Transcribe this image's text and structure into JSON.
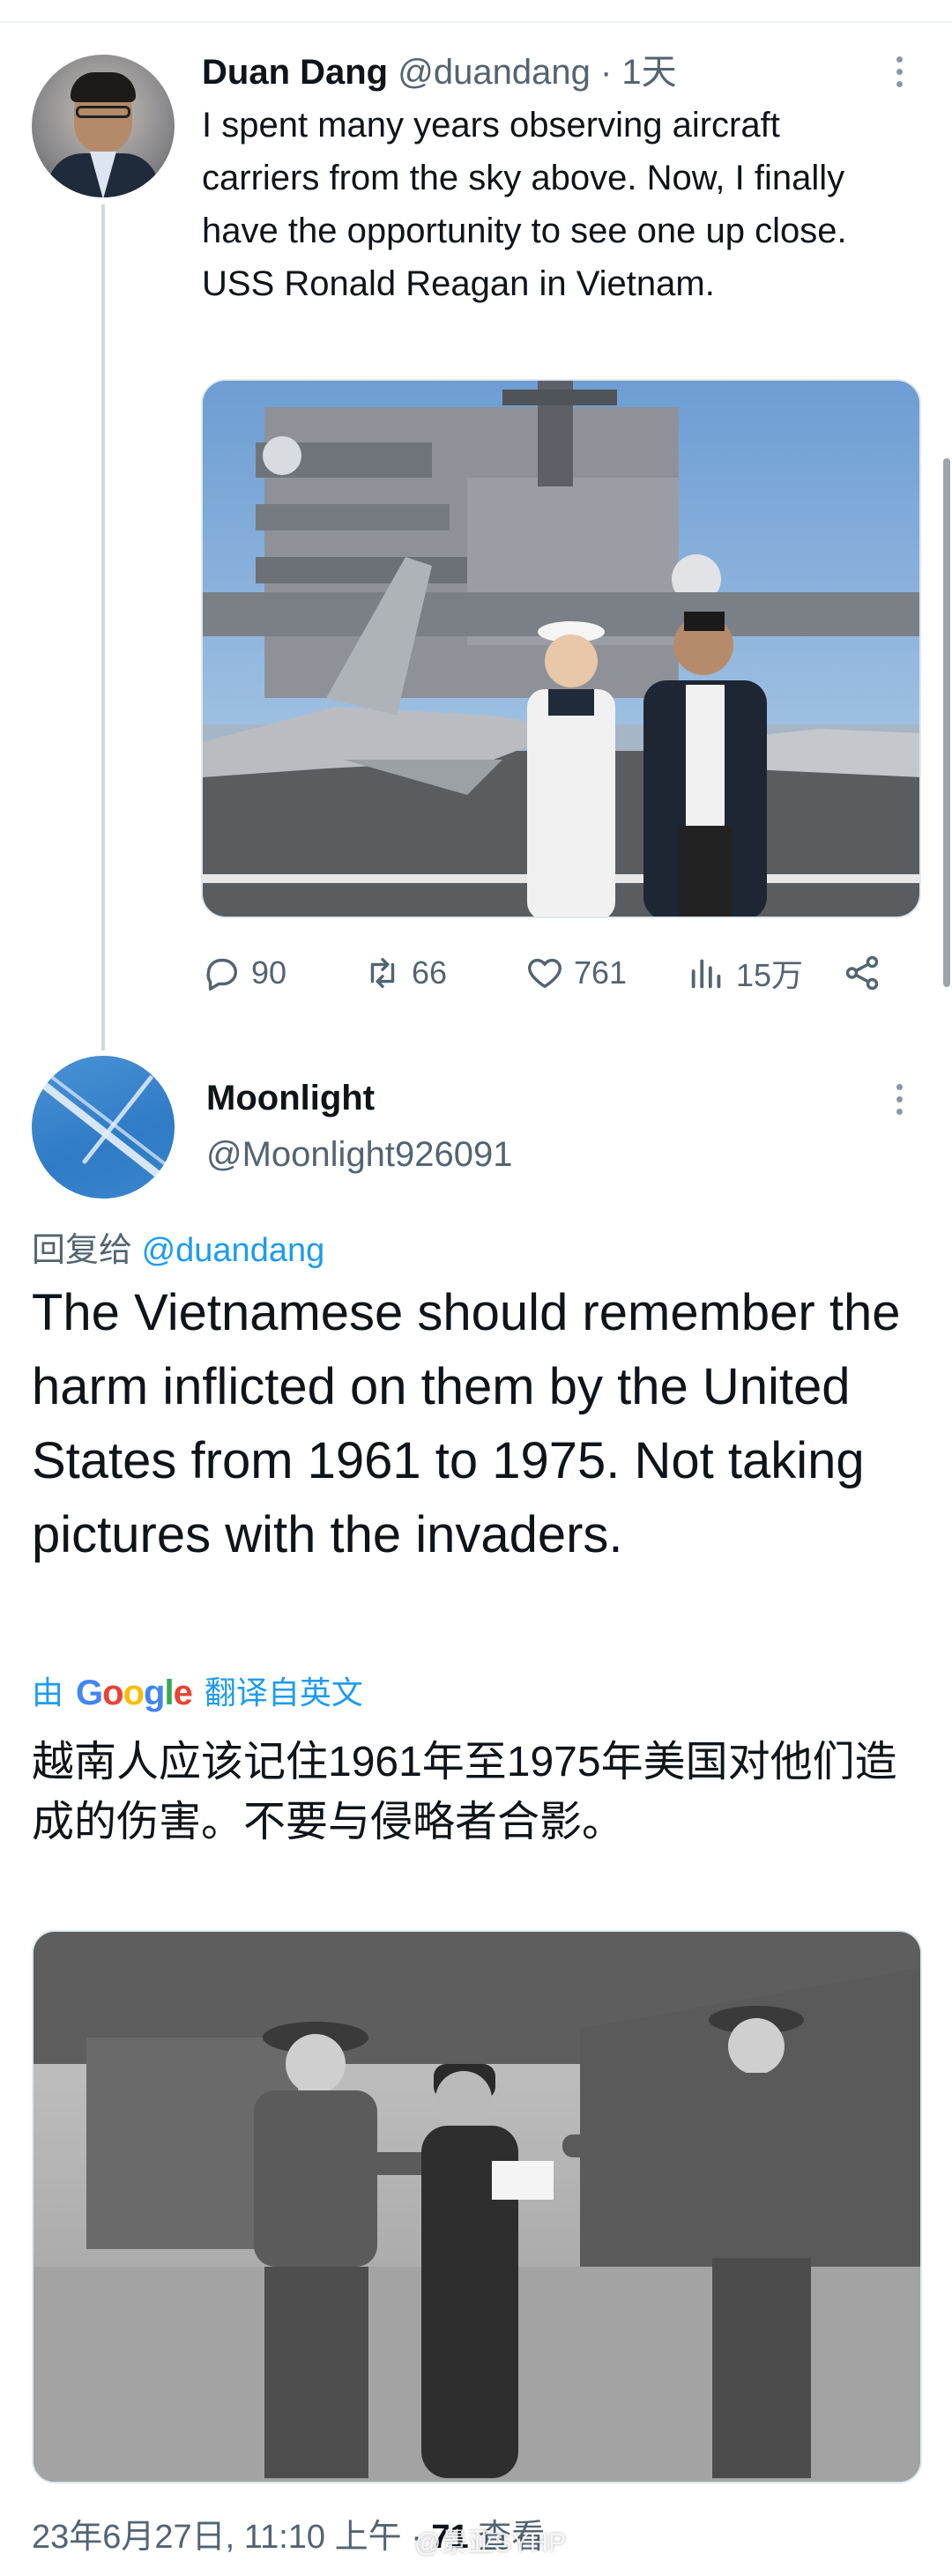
{
  "tweet1": {
    "author_name": "Duan Dang",
    "handle": "@duandang",
    "separator": "·",
    "time": "1天",
    "text": "I spent many years observing aircraft carriers from the sky above. Now, I finally have the opportunity to see one up close. USS Ronald Reagan in Vietnam.",
    "image_icon": "photo-aircraft-carrier-deck",
    "actions": {
      "replies": "90",
      "retweets": "66",
      "likes": "761",
      "views": "15万"
    }
  },
  "tweet2": {
    "author_name": "Moonlight",
    "handle": "@Moonlight926091",
    "reply_prefix": "回复给",
    "reply_mention": "@duandang",
    "text": "The Vietnamese should remember the harm inflicted on them by the United States from 1961 to 1975. Not taking pictures with the invaders.",
    "translate_by": "由",
    "translate_logo": "Google",
    "translate_from": "翻译自英文",
    "translated_text": "越南人应该记住1961年至1975年美国对他们造成的伤害。不要与侵略者合影。",
    "image_icon": "photo-black-and-white-soldiers",
    "timestamp": "23年6月27日, 11:10 上午",
    "timestamp_separator": "·",
    "views_count": "71",
    "views_label": "查看"
  },
  "watermark": "@景亚SYHP",
  "colors": {
    "accent": "#1d9bf0",
    "secondary_text": "#536471",
    "primary_text": "#0f1419",
    "thread_line": "#cfd9de"
  }
}
